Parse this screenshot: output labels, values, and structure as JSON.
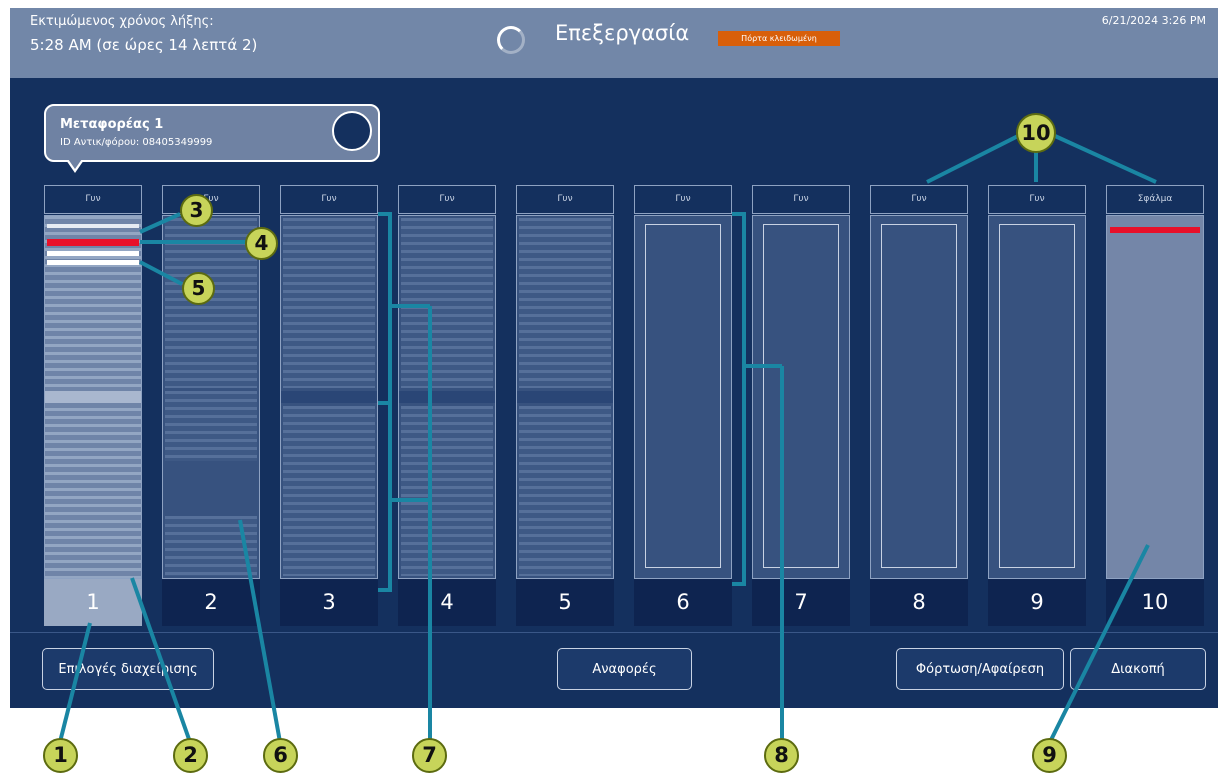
{
  "header": {
    "eta_label": "Εκτιμώμενος χρόνος λήξης:",
    "eta_value": "5:28 AM (σε ώρες 14 λεπτά 2)",
    "title": "Επεξεργασία",
    "door_status": "Πόρτα κλειδωμένη",
    "datetime": "6/21/2024 3:26 PM"
  },
  "carrier": {
    "name": "Μεταφορέας 1",
    "id_text": "ID Αντικ/φόρου: 08405349999"
  },
  "slots": [
    {
      "label": "Γυν",
      "number": "1",
      "state": "selected"
    },
    {
      "label": "Γυν",
      "number": "2",
      "state": "loaded"
    },
    {
      "label": "Γυν",
      "number": "3",
      "state": "loaded"
    },
    {
      "label": "Γυν",
      "number": "4",
      "state": "loaded"
    },
    {
      "label": "Γυν",
      "number": "5",
      "state": "loaded"
    },
    {
      "label": "Γυν",
      "number": "6",
      "state": "empty"
    },
    {
      "label": "Γυν",
      "number": "7",
      "state": "empty"
    },
    {
      "label": "Γυν",
      "number": "8",
      "state": "empty"
    },
    {
      "label": "Γυν",
      "number": "9",
      "state": "empty"
    },
    {
      "label": "Σφάλμα",
      "number": "10",
      "state": "error"
    }
  ],
  "buttons": {
    "management": "Επιλογές διαχείρισης",
    "reports": "Αναφορές",
    "load_remove": "Φόρτωση/Αφαίρεση",
    "stop": "Διακοπή"
  },
  "callouts": [
    "1",
    "2",
    "3",
    "4",
    "5",
    "6",
    "7",
    "8",
    "9",
    "10"
  ],
  "colors": {
    "background": "#14305e",
    "header": "#7287a8",
    "door_badge": "#d85f0a",
    "callout_fill": "#c7d45a",
    "callout_line": "#1a86a3",
    "error_bar": "#e8102a"
  }
}
